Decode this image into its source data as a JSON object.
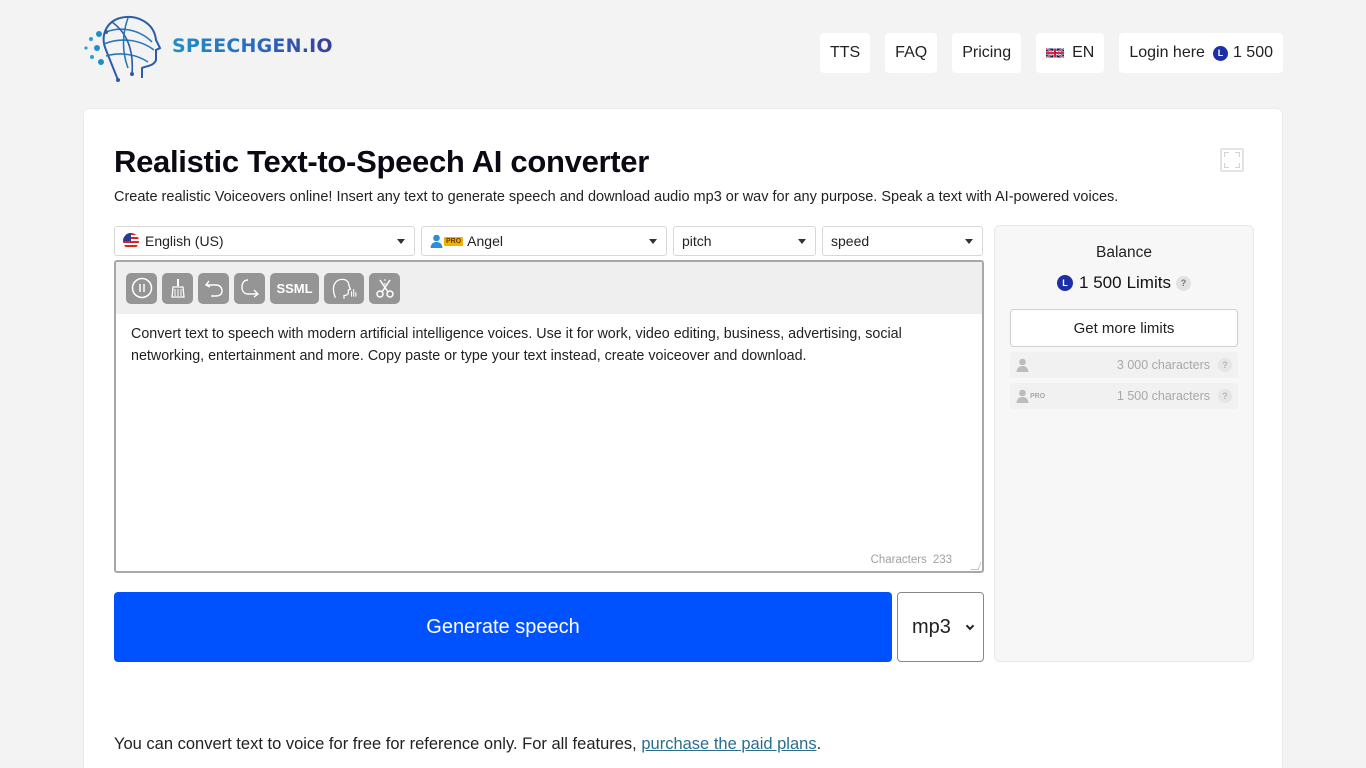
{
  "brand": {
    "logo_icon": "ai-head-network-icon",
    "name": "SPEECHGEN.IO"
  },
  "nav": {
    "items": [
      {
        "label": "TTS"
      },
      {
        "label": "FAQ"
      },
      {
        "label": "Pricing"
      },
      {
        "label": "EN",
        "icon": "uk-flag-icon"
      },
      {
        "label": "Login here",
        "balance_icon": "limits-coin-icon",
        "coin_letter": "L",
        "balance": "1 500"
      }
    ]
  },
  "main": {
    "title": "Realistic Text-to-Speech AI converter",
    "subtitle": "Create realistic Voiceovers online! Insert any text to generate speech and download audio mp3 or wav for any purpose. Speak a text with AI-powered voices.",
    "fullscreen_icon": "fullscreen-icon",
    "selects": {
      "language": {
        "value": "English (US)",
        "icon": "us-flag-icon"
      },
      "voice": {
        "value": "Angel",
        "badge": "PRO",
        "icon": "pro-user-icon"
      },
      "pitch": {
        "value": "pitch"
      },
      "speed": {
        "value": "speed"
      }
    },
    "toolbar": [
      {
        "name": "pause",
        "icon": "pause-icon"
      },
      {
        "name": "clear",
        "icon": "broom-icon"
      },
      {
        "name": "undo",
        "icon": "undo-icon"
      },
      {
        "name": "redo",
        "icon": "redo-icon"
      },
      {
        "name": "ssml",
        "label": "SSML"
      },
      {
        "name": "voice-effects",
        "icon": "head-voice-icon"
      },
      {
        "name": "cut",
        "icon": "scissors-icon"
      }
    ],
    "text": "Convert text to speech with modern artificial intelligence voices. Use it for work, video editing, business, advertising, social networking, entertainment and more. Copy paste or type your text instead, create voiceover and download.",
    "char_count_label": "Characters",
    "char_count": "233",
    "generate_label": "Generate speech",
    "format": {
      "value": "mp3"
    },
    "footnote": {
      "text": "You can convert text to voice for free for reference only. For all features, ",
      "link": "purchase the paid plans",
      "end": "."
    }
  },
  "balance": {
    "title": "Balance",
    "coin_letter": "L",
    "amount": "1 500",
    "unit": "Limits",
    "help": "?",
    "more_button": "Get more limits",
    "limits": [
      {
        "type": "free",
        "icon": "user-icon",
        "value": "3 000 characters",
        "help": "?"
      },
      {
        "type": "pro",
        "icon": "pro-user-icon",
        "badge": "PRO",
        "value": "1 500 characters",
        "help": "?"
      }
    ]
  },
  "colors": {
    "primary": "#0051ff",
    "coin": "#1e2fa6",
    "link": "#2b6e8c",
    "tool": "#959595"
  }
}
